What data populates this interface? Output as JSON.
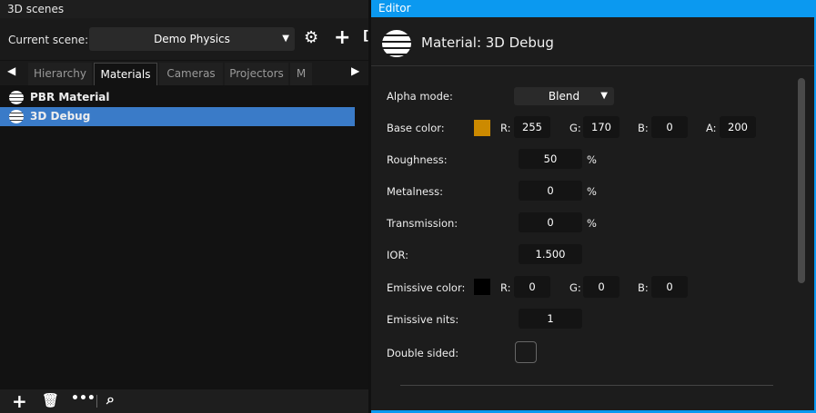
{
  "left_panel": {
    "title": "3D scenes",
    "current_scene_label": "Current scene:",
    "current_scene": "Demo Physics",
    "tabs": [
      "Hierarchy",
      "Materials",
      "Cameras",
      "Projectors",
      "M"
    ],
    "active_tab": "Materials",
    "materials": [
      "PBR Material",
      "3D Debug"
    ],
    "selected": "3D Debug"
  },
  "editor": {
    "title": "Editor",
    "heading": "Material: 3D Debug",
    "alpha_mode": {
      "label": "Alpha mode:",
      "value": "Blend"
    },
    "base_color": {
      "label": "Base color:",
      "swatch": "#cc8a00",
      "r_label": "R:",
      "r": "255",
      "g_label": "G:",
      "g": "170",
      "b_label": "B:",
      "b": "0",
      "a_label": "A:",
      "a": "200"
    },
    "roughness": {
      "label": "Roughness:",
      "value": "50",
      "unit": "%"
    },
    "metalness": {
      "label": "Metalness:",
      "value": "0",
      "unit": "%"
    },
    "transmission": {
      "label": "Transmission:",
      "value": "0",
      "unit": "%"
    },
    "ior": {
      "label": "IOR:",
      "value": "1.500"
    },
    "emissive_color": {
      "label": "Emissive color:",
      "swatch": "#000000",
      "r_label": "R:",
      "r": "0",
      "g_label": "G:",
      "g": "0",
      "b_label": "B:",
      "b": "0"
    },
    "emissive_nits": {
      "label": "Emissive nits:",
      "value": "1"
    },
    "double_sided": {
      "label": "Double sided:",
      "checked": false
    }
  }
}
